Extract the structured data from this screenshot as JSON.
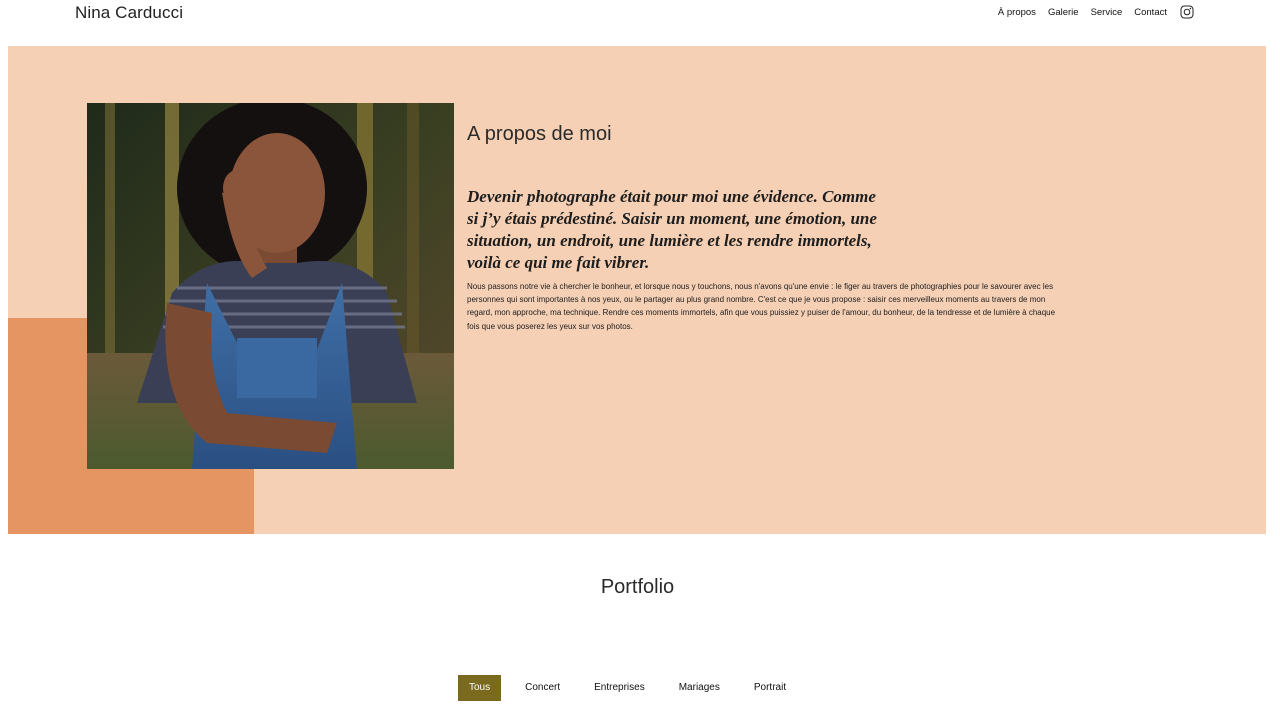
{
  "header": {
    "brand": "Nina Carducci",
    "nav": [
      "À propos",
      "Galerie",
      "Service",
      "Contact"
    ],
    "social_icon": "instagram-icon"
  },
  "about": {
    "title": "A propos de moi",
    "quote": "Devenir photographe était pour moi une évidence. Comme si j’y étais prédestiné. Saisir un moment, une émotion, une situation, un endroit, une lumière et les rendre immortels, voilà ce qui me fait vibrer.",
    "text": "Nous passons notre vie à chercher le bonheur, et lorsque nous y touchons, nous n'avons qu'une envie : le figer au travers de photographies pour le savourer avec les personnes qui sont importantes à nos yeux, ou le partager au plus grand nombre. C'est ce que je vous propose : saisir ces merveilleux moments au travers de mon regard, mon approche, ma technique. Rendre ces moments immortels, afin que vous puissiez y puiser de l'amour, du bonheur, de la tendresse et de lumière à chaque fois que vous poserez les yeux sur vos photos."
  },
  "portfolio": {
    "title": "Portfolio",
    "filters": [
      "Tous",
      "Concert",
      "Entreprises",
      "Mariages",
      "Portrait"
    ],
    "active_filter": "Tous"
  },
  "colors": {
    "about_bg": "#f5d0b5",
    "accent": "#e59561",
    "filter_active": "#7a6a1d"
  }
}
